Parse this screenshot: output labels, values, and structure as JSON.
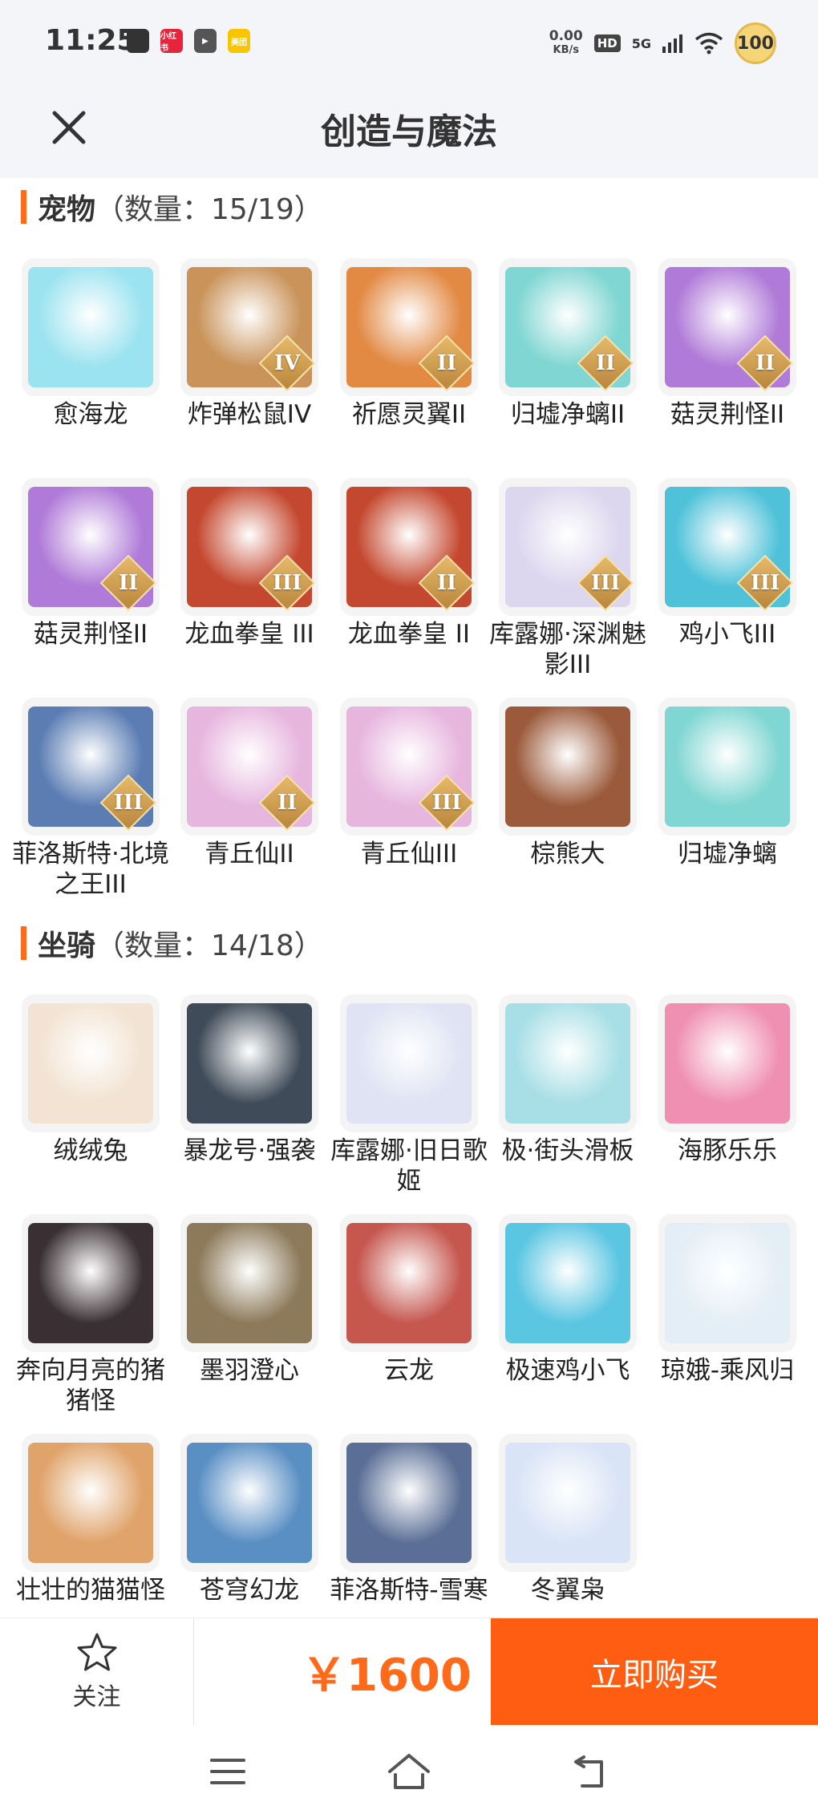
{
  "status_bar": {
    "time": "11:25",
    "app_icons": [
      {
        "name": "clipboard-icon",
        "text": "",
        "color": "#333333"
      },
      {
        "name": "xiaohongshu-icon",
        "text": "小红书",
        "color": "#e8243c"
      },
      {
        "name": "video-app-icon",
        "text": "▶",
        "color": "#555555"
      },
      {
        "name": "meituan-icon",
        "text": "美团",
        "color": "#f7c600"
      }
    ],
    "net_speed_value": "0.00",
    "net_speed_unit": "KB/s",
    "hd_label": "HD",
    "network_label": "5G",
    "battery": "100"
  },
  "header": {
    "title": "创造与魔法"
  },
  "pets": {
    "name": "宠物",
    "count": "（数量：15/19）",
    "items": [
      {
        "label": "愈海龙",
        "badge": "",
        "color": "#9be3f0"
      },
      {
        "label": "炸弹松鼠IV",
        "badge": "IV",
        "color": "#c9935a"
      },
      {
        "label": "祈愿灵翼II",
        "badge": "II",
        "color": "#e28a44"
      },
      {
        "label": "归墟净螭II",
        "badge": "II",
        "color": "#7fd6d2"
      },
      {
        "label": "菇灵荆怪II",
        "badge": "II",
        "color": "#b07ad8"
      },
      {
        "label": "菇灵荆怪II",
        "badge": "II",
        "color": "#b07ad8"
      },
      {
        "label": "龙血拳皇 III",
        "badge": "III",
        "color": "#c4482f"
      },
      {
        "label": "龙血拳皇 II",
        "badge": "II",
        "color": "#c4482f"
      },
      {
        "label": "库露娜·深渊魅影III",
        "badge": "III",
        "color": "#dcd6ee"
      },
      {
        "label": "鸡小飞III",
        "badge": "III",
        "color": "#4fc2d9"
      },
      {
        "label": "菲洛斯特·北境之王III",
        "badge": "III",
        "color": "#5b7db3"
      },
      {
        "label": "青丘仙II",
        "badge": "II",
        "color": "#e7b6df"
      },
      {
        "label": "青丘仙III",
        "badge": "III",
        "color": "#e7b6df"
      },
      {
        "label": "棕熊大",
        "badge": "",
        "color": "#9b5a3b"
      },
      {
        "label": "归墟净螭",
        "badge": "",
        "color": "#7fd6d2"
      }
    ]
  },
  "mounts": {
    "name": "坐骑",
    "count": "（数量：14/18）",
    "items": [
      {
        "label": "绒绒兔",
        "badge": "",
        "color": "#f2e3d2"
      },
      {
        "label": "暴龙号·强袭",
        "badge": "",
        "color": "#3f4b58"
      },
      {
        "label": "库露娜·旧日歌姬",
        "badge": "",
        "color": "#dfe3f3"
      },
      {
        "label": "极·街头滑板",
        "badge": "",
        "color": "#a8dfe6"
      },
      {
        "label": "海豚乐乐",
        "badge": "",
        "color": "#ef8fb1"
      },
      {
        "label": "奔向月亮的猪猪怪",
        "badge": "",
        "color": "#3a3034"
      },
      {
        "label": "墨羽澄心",
        "badge": "",
        "color": "#8c7a5a"
      },
      {
        "label": "云龙",
        "badge": "",
        "color": "#c5574f"
      },
      {
        "label": "极速鸡小飞",
        "badge": "",
        "color": "#5bc6e2"
      },
      {
        "label": "琼娥-乘风归",
        "badge": "",
        "color": "#e4eef6"
      },
      {
        "label": "壮壮的猫猫怪",
        "badge": "",
        "color": "#e0a36a"
      },
      {
        "label": "苍穹幻龙",
        "badge": "",
        "color": "#5a8fc4"
      },
      {
        "label": "菲洛斯特-雪寒",
        "badge": "",
        "color": "#5b6f96"
      },
      {
        "label": "冬翼枭",
        "badge": "",
        "color": "#d9e4f6"
      }
    ]
  },
  "bottom_bar": {
    "follow_label": "关注",
    "price": "￥1600",
    "buy_label": "立即购买"
  }
}
